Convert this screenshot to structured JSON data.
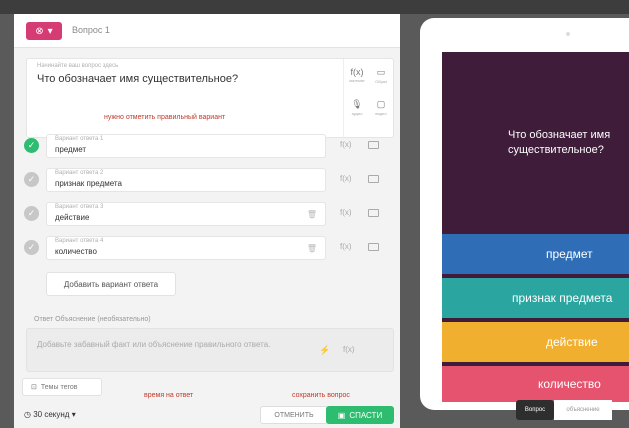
{
  "header": {
    "question_title": "Вопрос 1"
  },
  "question": {
    "label": "Начинайте ваш вопрос здесь",
    "text": "Что обозначает имя существительное?",
    "tools": [
      {
        "symbol": "f(x)",
        "caption": "математ"
      },
      {
        "symbol": "▭",
        "caption": "Образ"
      },
      {
        "symbol": "🎙",
        "caption": "аудио"
      },
      {
        "symbol": "▢",
        "caption": "видео"
      }
    ]
  },
  "annotations": {
    "mark_correct": "нужно отметить правильный вариант",
    "time_to_answer": "время на ответ",
    "save_question": "сохранить вопрос"
  },
  "answers": [
    {
      "label": "Вариант ответа 1",
      "value": "предмет",
      "correct": true
    },
    {
      "label": "Вариант ответа 2",
      "value": "признак предмета",
      "correct": false
    },
    {
      "label": "Вариант ответа 3",
      "value": "действие",
      "correct": false
    },
    {
      "label": "Вариант ответа 4",
      "value": "количество",
      "correct": false
    }
  ],
  "answer_tools": {
    "formula": "f(x)"
  },
  "add_answer_label": "Добавить вариант ответа",
  "explanation": {
    "label": "Ответ Объяснение (необязательно)",
    "placeholder": "Добавьте забавный факт или объяснение правильного ответа."
  },
  "footer": {
    "topics": "Темы тегов",
    "time": "30 секунд",
    "cancel": "ОТМЕНИТЬ",
    "save": "СПАСТИ"
  },
  "preview": {
    "question": "Что обозначает имя существительное?",
    "options": [
      "предмет",
      "признак предмета",
      "действие",
      "количество"
    ],
    "option_colors": [
      "#2f6eb6",
      "#2aa5a0",
      "#f1af2f",
      "#e5536e"
    ],
    "tabs": [
      "Вопрос",
      "объяснение"
    ],
    "background": "#3e1c3a"
  },
  "colors": {
    "accent_pink": "#d63c74",
    "success_green": "#2ebc70",
    "annotation_red": "#c0392b"
  }
}
